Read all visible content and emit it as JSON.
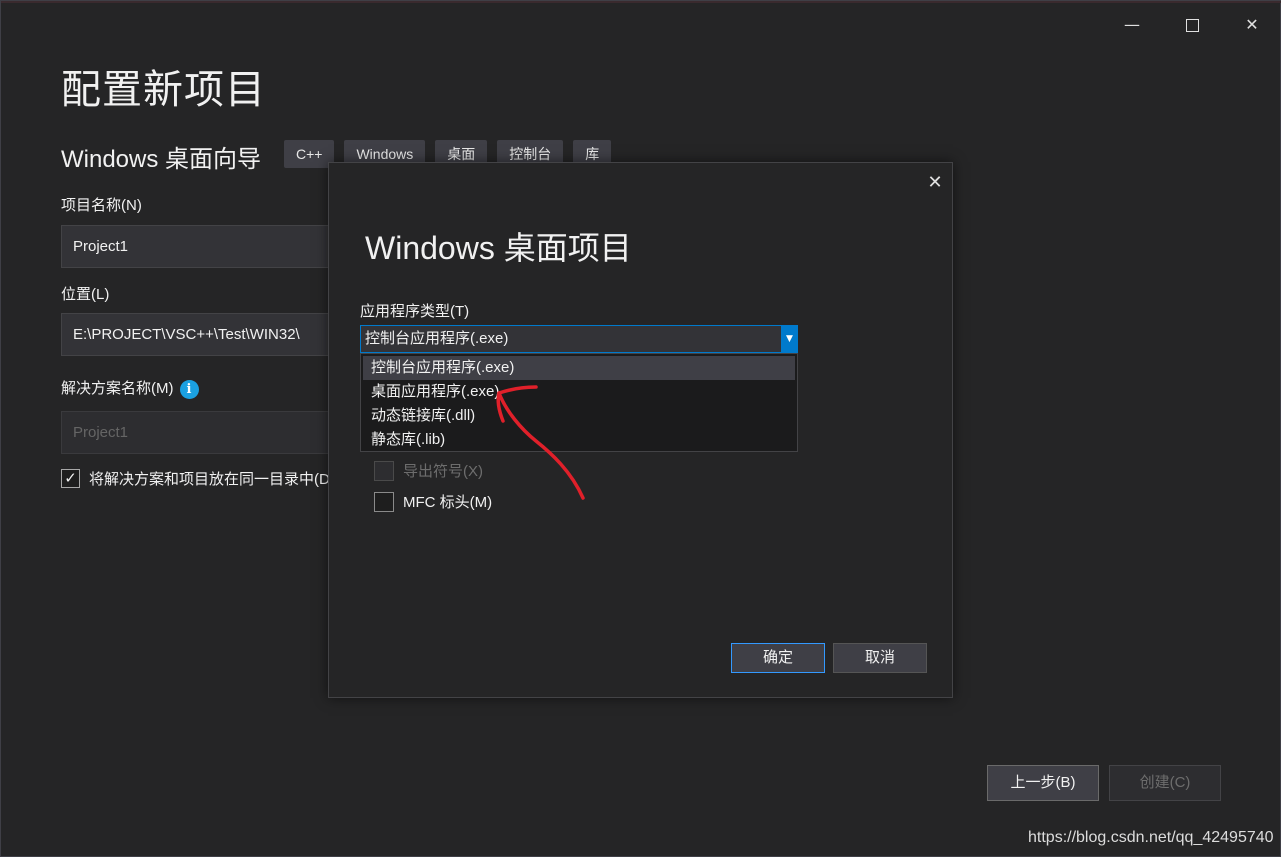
{
  "window": {
    "minimize_glyph": "—",
    "close_glyph": "✕"
  },
  "page": {
    "title": "配置新项目",
    "template_name": "Windows 桌面向导",
    "tags": [
      "C++",
      "Windows",
      "桌面",
      "控制台",
      "库"
    ]
  },
  "form": {
    "project_name_label": "项目名称(N)",
    "project_name_value": "Project1",
    "location_label": "位置(L)",
    "location_value": "E:\\PROJECT\\VSC++\\Test\\WIN32\\",
    "solution_name_label": "解决方案名称(M)",
    "solution_name_value": "Project1",
    "info_glyph": "i",
    "same_dir_label": "将解决方案和项目放在同一目录中(D",
    "same_dir_checked": true,
    "check_glyph": "✓"
  },
  "footer": {
    "back_label": "上一步(B)",
    "create_label": "创建(C)"
  },
  "watermark": "https://blog.csdn.net/qq_42495740",
  "dialog": {
    "close_glyph": "✕",
    "title": "Windows 桌面项目",
    "app_type_label": "应用程序类型(T)",
    "app_type_selected": "控制台应用程序(.exe)",
    "arrow_glyph": "▼",
    "options": [
      "控制台应用程序(.exe)",
      "桌面应用程序(.exe)",
      "动态链接库(.dll)",
      "静态库(.lib)"
    ],
    "export_symbols_label": "导出符号(X)",
    "mfc_headers_label": "MFC 标头(M)",
    "ok_label": "确定",
    "cancel_label": "取消"
  },
  "colors": {
    "background": "#252526",
    "accent": "#007acc",
    "annotation": "#e0202a"
  }
}
